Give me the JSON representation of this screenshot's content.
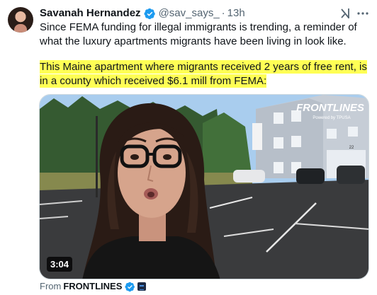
{
  "author": {
    "display_name": "Savanah Hernandez",
    "handle": "@sav_says_",
    "separator": "·",
    "timestamp": "13h"
  },
  "post": {
    "text": "Since FEMA funding for illegal immigrants is trending, a reminder of what the luxury apartments migrants have been living in look like.",
    "highlighted_text": "This Maine apartment where migrants received 2 years of free rent, is in a county which received $6.1 mill from FEMA:"
  },
  "video": {
    "duration": "3:04",
    "watermark": "FRONTLINES",
    "watermark_sub": "Powered by TPUSA",
    "building_number": "22"
  },
  "attribution": {
    "prefix": "From",
    "source": "FRONTLINES"
  },
  "colors": {
    "verified": "#1d9bf0",
    "highlight": "#ffff55",
    "secondary_text": "#536471"
  },
  "icons": [
    "verified-badge-icon",
    "grok-icon",
    "more-options-icon",
    "org-affiliation-icon"
  ]
}
